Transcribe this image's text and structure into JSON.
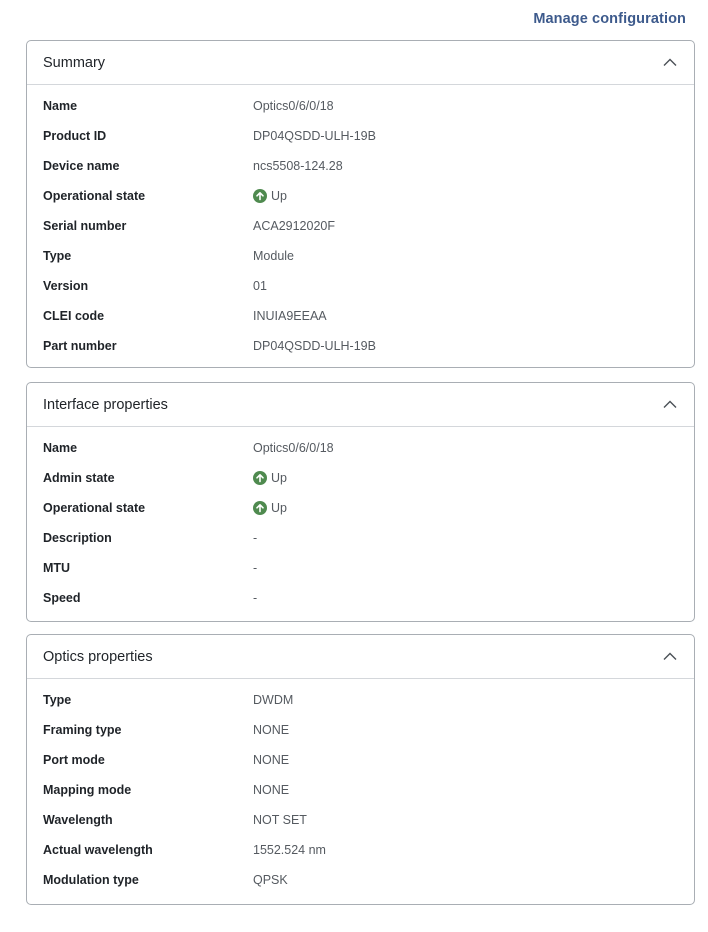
{
  "header": {
    "manage_link": "Manage configuration"
  },
  "colors": {
    "link": "#3d5a8c",
    "status_up": "#4f8a4f",
    "border": "#a9aeb4"
  },
  "sections": [
    {
      "title": "Summary",
      "expanded": true,
      "rows": [
        {
          "label": "Name",
          "value": "Optics0/6/0/18"
        },
        {
          "label": "Product ID",
          "value": "DP04QSDD-ULH-19B"
        },
        {
          "label": "Device name",
          "value": "ncs5508-124.28"
        },
        {
          "label": "Operational state",
          "value": "Up",
          "icon": "arrow-up-circle-icon"
        },
        {
          "label": "Serial number",
          "value": "ACA2912020F"
        },
        {
          "label": "Type",
          "value": "Module"
        },
        {
          "label": "Version",
          "value": "01"
        },
        {
          "label": "CLEI code",
          "value": "INUIA9EEAA"
        },
        {
          "label": "Part number",
          "value": "DP04QSDD-ULH-19B"
        }
      ]
    },
    {
      "title": "Interface properties",
      "expanded": true,
      "rows": [
        {
          "label": "Name",
          "value": "Optics0/6/0/18"
        },
        {
          "label": "Admin state",
          "value": "Up",
          "icon": "arrow-up-circle-icon"
        },
        {
          "label": "Operational state",
          "value": "Up",
          "icon": "arrow-up-circle-icon"
        },
        {
          "label": "Description",
          "value": "-"
        },
        {
          "label": "MTU",
          "value": "-"
        },
        {
          "label": "Speed",
          "value": "-"
        }
      ]
    },
    {
      "title": "Optics properties",
      "expanded": true,
      "rows": [
        {
          "label": "Type",
          "value": "DWDM"
        },
        {
          "label": "Framing type",
          "value": "NONE"
        },
        {
          "label": "Port mode",
          "value": "NONE"
        },
        {
          "label": "Mapping mode",
          "value": "NONE"
        },
        {
          "label": "Wavelength",
          "value": "NOT SET"
        },
        {
          "label": "Actual wavelength",
          "value": "1552.524 nm"
        },
        {
          "label": "Modulation type",
          "value": "QPSK"
        }
      ]
    }
  ]
}
